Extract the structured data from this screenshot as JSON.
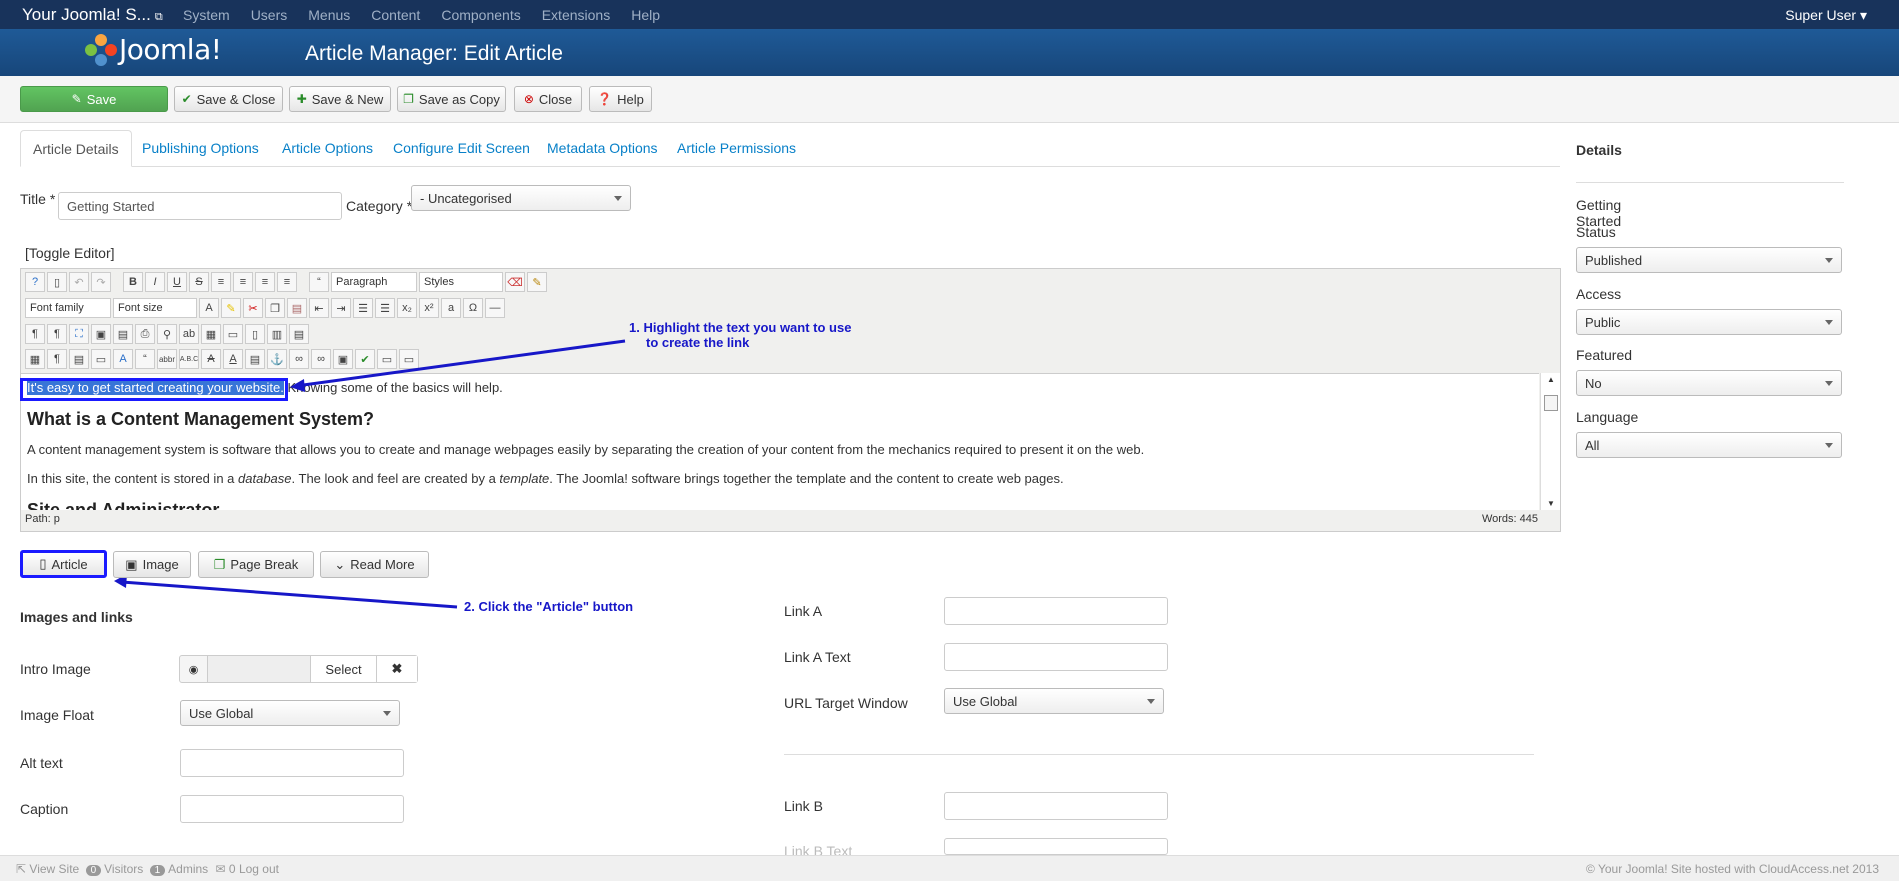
{
  "topnav": {
    "site": "Your Joomla! S...",
    "menu": [
      "System",
      "Users",
      "Menus",
      "Content",
      "Components",
      "Extensions",
      "Help"
    ],
    "user": "Super User"
  },
  "header": {
    "logo": "Joomla!",
    "title": "Article Manager: Edit Article"
  },
  "toolbar": {
    "save": "Save",
    "save_close": "Save & Close",
    "save_new": "Save & New",
    "save_copy": "Save as Copy",
    "close": "Close",
    "help": "Help"
  },
  "tabs": [
    "Article Details",
    "Publishing Options",
    "Article Options",
    "Configure Edit Screen",
    "Metadata Options",
    "Article Permissions"
  ],
  "form": {
    "title_label": "Title *",
    "title_value": "Getting Started",
    "category_label": "Category *",
    "category_value": "- Uncategorised",
    "toggle_editor": "[Toggle Editor]"
  },
  "editor": {
    "format": "Paragraph",
    "styles": "Styles",
    "font_family": "Font family",
    "font_size": "Font size",
    "highlight": "It's easy to get started creating your website.",
    "after_highlight": " Knowing some of the basics will help.",
    "h1": "What is a Content Management System?",
    "p1": "A content management system is software that allows you to create and manage webpages easily by separating the creation of your content from the mechanics required to present it on the web.",
    "p2a": "In this site, the content is stored in a ",
    "p2b": "database",
    "p2c": ". The look and feel are created by a ",
    "p2d": "template",
    "p2e": ". The Joomla! software brings together the template and the content to create web pages.",
    "h2": "Site and Administrator",
    "path": "Path:  p",
    "words": "Words: 445"
  },
  "buttons": {
    "article": "Article",
    "image": "Image",
    "page_break": "Page Break",
    "read_more": "Read More"
  },
  "annotations": {
    "a1_line1": "1. Highlight the text you want to use",
    "a1_line2": "to create the link",
    "a2": "2. Click the \"Article\" button"
  },
  "images": {
    "heading": "Images and links",
    "intro_image": "Intro Image",
    "select": "Select",
    "image_float": "Image Float",
    "image_float_value": "Use Global",
    "alt_text": "Alt text",
    "caption": "Caption"
  },
  "links": {
    "link_a": "Link A",
    "link_a_text": "Link A Text",
    "url_target": "URL Target Window",
    "url_target_value": "Use Global",
    "link_b": "Link B",
    "link_b_text": "Link B Text"
  },
  "sidebar": {
    "heading": "Details",
    "article_title": "Getting Started",
    "status_label": "Status",
    "status_value": "Published",
    "access_label": "Access",
    "access_value": "Public",
    "featured_label": "Featured",
    "featured_value": "No",
    "language_label": "Language",
    "language_value": "All"
  },
  "footer": {
    "view_site": "View Site",
    "visitors_count": "0",
    "visitors": "Visitors",
    "admins_count": "1",
    "admins": "Admins",
    "logout_count": "0",
    "logout": "Log out",
    "copyright": "© Your Joomla! Site hosted with CloudAccess.net 2013"
  },
  "colors": {
    "topnav": "#18335b",
    "header": "#1f5a97",
    "save_green": "#51a351",
    "link": "#0880c8",
    "annotation": "#1717c8"
  }
}
